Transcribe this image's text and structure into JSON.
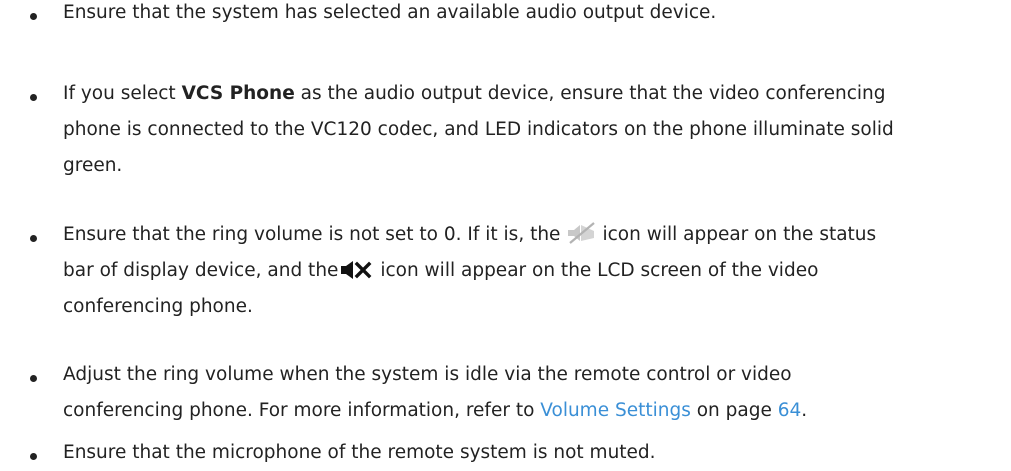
{
  "items": [
    {
      "lines": [
        "Ensure that the system has selected an available audio output device."
      ]
    },
    {
      "l1_pre": "If you select ",
      "l1_bold": "VCS Phone",
      "l1_post": " as the audio output device, ensure that the video conferencing",
      "l2": "phone is connected to the VC120 codec, and LED indicators on the phone illuminate solid",
      "l3": "green."
    },
    {
      "l1_pre": "Ensure that the ring volume is not set to 0. If it is, the",
      "l1_post": "icon will appear on the status",
      "l2_pre": "bar of display device, and the",
      "l2_post": " icon will appear on the LCD screen of the video",
      "l3": "conferencing phone.",
      "icons": [
        "muted-ring-icon",
        "speaker-muted-icon"
      ]
    },
    {
      "l1": "Adjust the ring volume when the system is idle via the remote control or video",
      "l2_pre": "conferencing phone. For more information, refer to ",
      "l2_link": "Volume Settings",
      "l2_mid": " on page ",
      "l2_page": "64",
      "l2_end": "."
    },
    {
      "lines": [
        "Ensure that the microphone of the remote system is not muted."
      ]
    }
  ],
  "colors": {
    "text": "#222222",
    "link": "#3a8fd6",
    "icon_gray": "#b9b9b9"
  }
}
